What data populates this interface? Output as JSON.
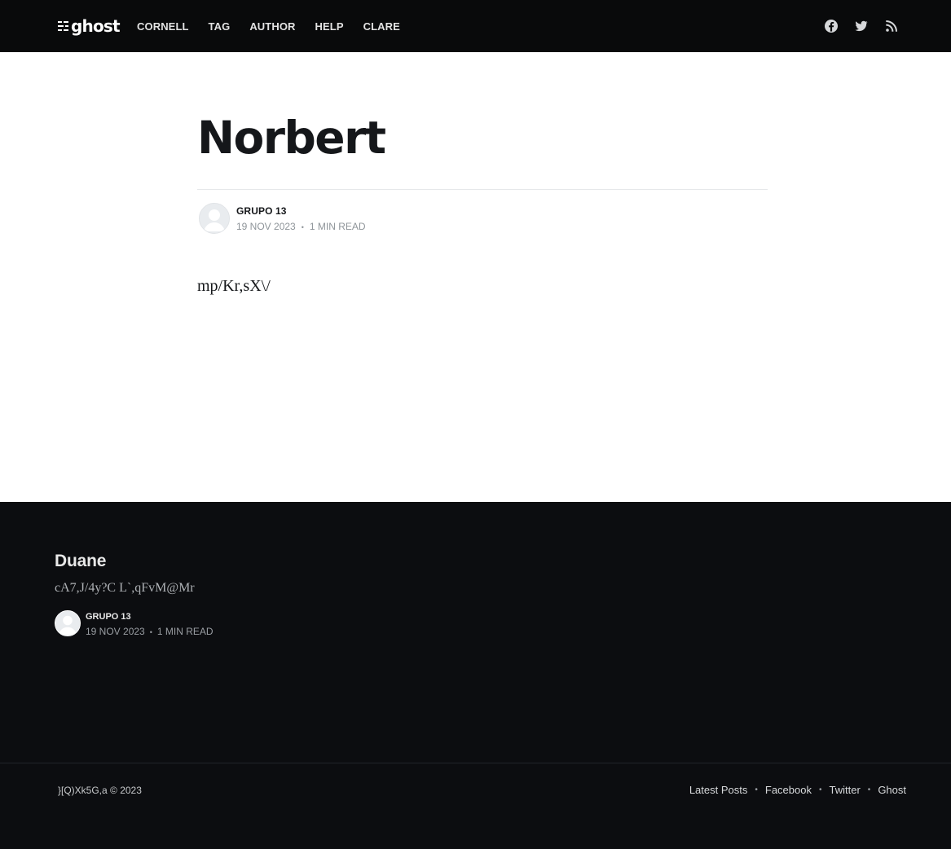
{
  "header": {
    "logo_text": "ghost",
    "nav": [
      "CORNELL",
      "TAG",
      "AUTHOR",
      "HELP",
      "CLARE"
    ],
    "social_icons": [
      "facebook-icon",
      "twitter-icon",
      "rss-icon"
    ]
  },
  "article": {
    "title": "Norbert",
    "author": "GRUPO 13",
    "date": "19 NOV 2023",
    "reading_time": "1 MIN READ",
    "content": "mp/Kr,sX\\/"
  },
  "footer_card": {
    "title": "Duane",
    "excerpt": "cA7,J/4y?C L`,qFvM@Mr",
    "author": "GRUPO 13",
    "date": "19 NOV 2023",
    "reading_time": "1 MIN READ"
  },
  "footer": {
    "copyright": "}[Q)Xk5G,a © 2023",
    "links": [
      "Latest Posts",
      "Facebook",
      "Twitter",
      "Ghost"
    ]
  },
  "colors": {
    "header_bg": "#090a0b",
    "footer_bg": "#0c0d10",
    "text_primary": "#15171a",
    "text_muted": "#8e9499"
  }
}
